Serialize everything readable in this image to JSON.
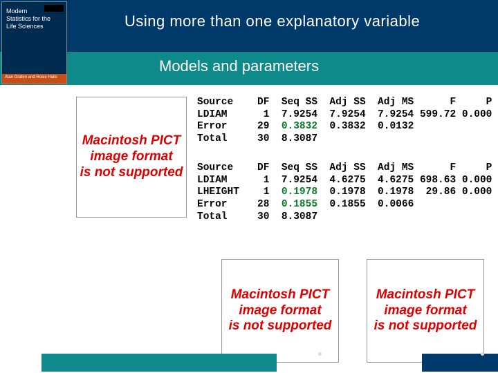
{
  "title": "Using more than one explanatory variable",
  "subtitle": "Models and parameters",
  "cover": {
    "line1": "Modern",
    "line2": "Statistics for the",
    "line3": "Life Sciences",
    "authors": "Alan Grafen and Rosie Hails"
  },
  "placeholder": {
    "line1": "Macintosh PICT",
    "line2": "image format",
    "line3": "is not supported"
  },
  "anova": {
    "table1": {
      "headers": {
        "c0": "Source",
        "c1": "DF",
        "c2": "Seq SS",
        "c3": "Adj SS",
        "c4": "Adj MS",
        "c5": "F",
        "c6": "P"
      },
      "rows": [
        {
          "c0": "LDIAM",
          "c1": "1",
          "c2": "7.9254",
          "c3": "7.9254",
          "c4": "7.9254",
          "c5": "599.72",
          "c6": "0.000"
        },
        {
          "c0": "Error",
          "c1": "29",
          "c2": "0.3832",
          "c3": "0.3832",
          "c4": "0.0132",
          "c5": "",
          "c6": "",
          "green_c2": true
        },
        {
          "c0": "Total",
          "c1": "30",
          "c2": "8.3087",
          "c3": "",
          "c4": "",
          "c5": "",
          "c6": ""
        }
      ]
    },
    "table2": {
      "headers": {
        "c0": "Source",
        "c1": "DF",
        "c2": "Seq SS",
        "c3": "Adj SS",
        "c4": "Adj MS",
        "c5": "F",
        "c6": "P"
      },
      "rows": [
        {
          "c0": "LDIAM",
          "c1": "1",
          "c2": "7.9254",
          "c3": "4.6275",
          "c4": "4.6275",
          "c5": "698.63",
          "c6": "0.000"
        },
        {
          "c0": "LHEIGHT",
          "c1": "1",
          "c2": "0.1978",
          "c3": "0.1978",
          "c4": "0.1978",
          "c5": "29.86",
          "c6": "0.000",
          "green_c2": true
        },
        {
          "c0": "Error",
          "c1": "28",
          "c2": "0.1855",
          "c3": "0.1855",
          "c4": "0.0066",
          "c5": "",
          "c6": "",
          "green_c2": true
        },
        {
          "c0": "Total",
          "c1": "30",
          "c2": "8.3087",
          "c3": "",
          "c4": "",
          "c5": "",
          "c6": ""
        }
      ]
    }
  }
}
